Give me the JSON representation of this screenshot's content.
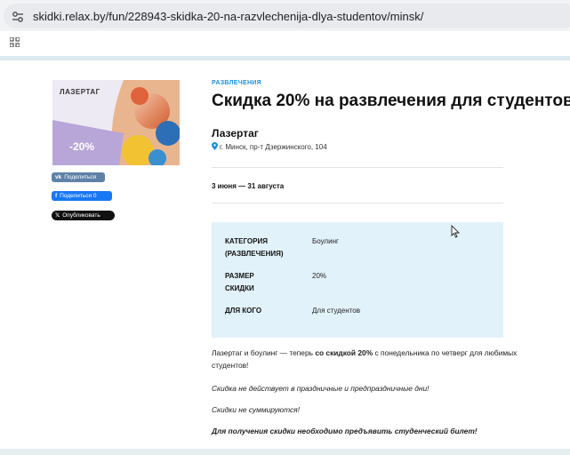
{
  "browser": {
    "url": "skidki.relax.by/fun/228943-skidka-20-na-razvlechenija-dlya-studentov/minsk/"
  },
  "promo": {
    "label": "ЛАЗЕРТАГ",
    "discount": "-20%"
  },
  "share": {
    "vk": "Поделиться",
    "facebook": "Поделиться 0",
    "x": "Опубликовать"
  },
  "offer": {
    "category": "РАЗВЛЕЧЕНИЯ",
    "title": "Скидка 20% на развлечения для студентов",
    "company": "Лазертаг",
    "address": "г. Минск, пр-т Дзержинского, 104",
    "dates": "3 июня — 31 августа"
  },
  "info": [
    {
      "key": "КАТЕГОРИЯ (РАЗВЛЕЧЕНИЯ)",
      "value": "Боулинг"
    },
    {
      "key": "РАЗМЕР СКИДКИ",
      "value": "20%"
    },
    {
      "key": "ДЛЯ КОГО",
      "value": "Для студентов"
    }
  ],
  "description": {
    "p1_start": "Лазертаг и боулинг — теперь ",
    "p1_bold": "со скидкой 20%",
    "p1_end": " с понедельника по четверг для любимых студентов!",
    "p2": "Скидка не действует в праздничные и предпраздничные дни!",
    "p3": "Скидки не суммируются!",
    "p4": "Для получения скидки необходимо предъявить студенческий билет!"
  },
  "colors": {
    "accent": "#1c8fd8",
    "info_bg": "#e2f2fa"
  }
}
